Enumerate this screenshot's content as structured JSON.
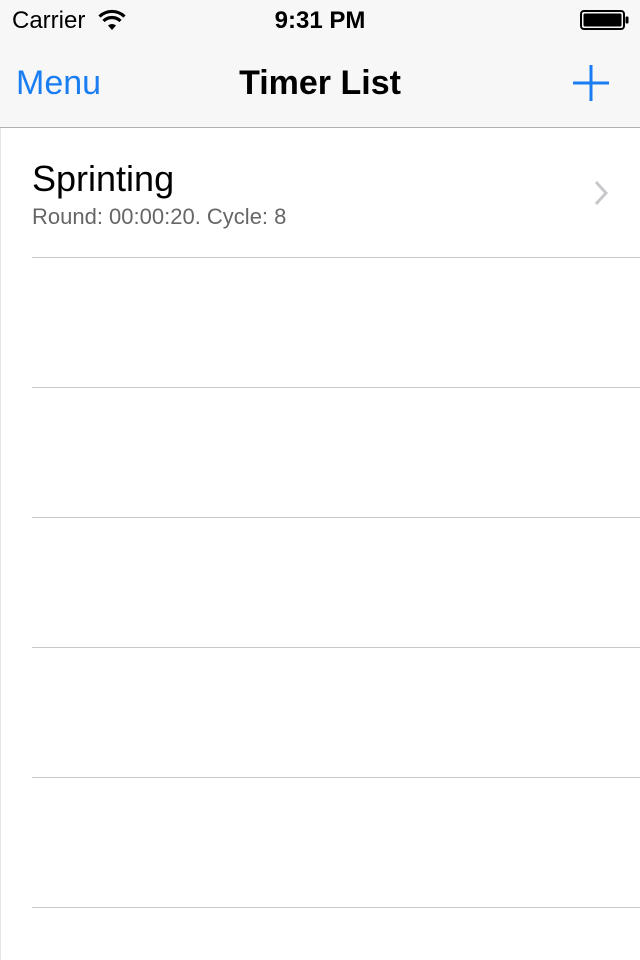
{
  "status_bar": {
    "carrier": "Carrier",
    "time": "9:31 PM",
    "wifi_icon": "wifi-icon",
    "battery_icon": "battery-icon"
  },
  "nav_bar": {
    "left_button": "Menu",
    "title": "Timer List",
    "right_icon": "plus-icon",
    "accent_color": "#1a7ef2"
  },
  "timers": [
    {
      "name": "Sprinting",
      "detail": "Round: 00:00:20. Cycle: 8",
      "accessory_icon": "chevron-right-icon"
    }
  ]
}
